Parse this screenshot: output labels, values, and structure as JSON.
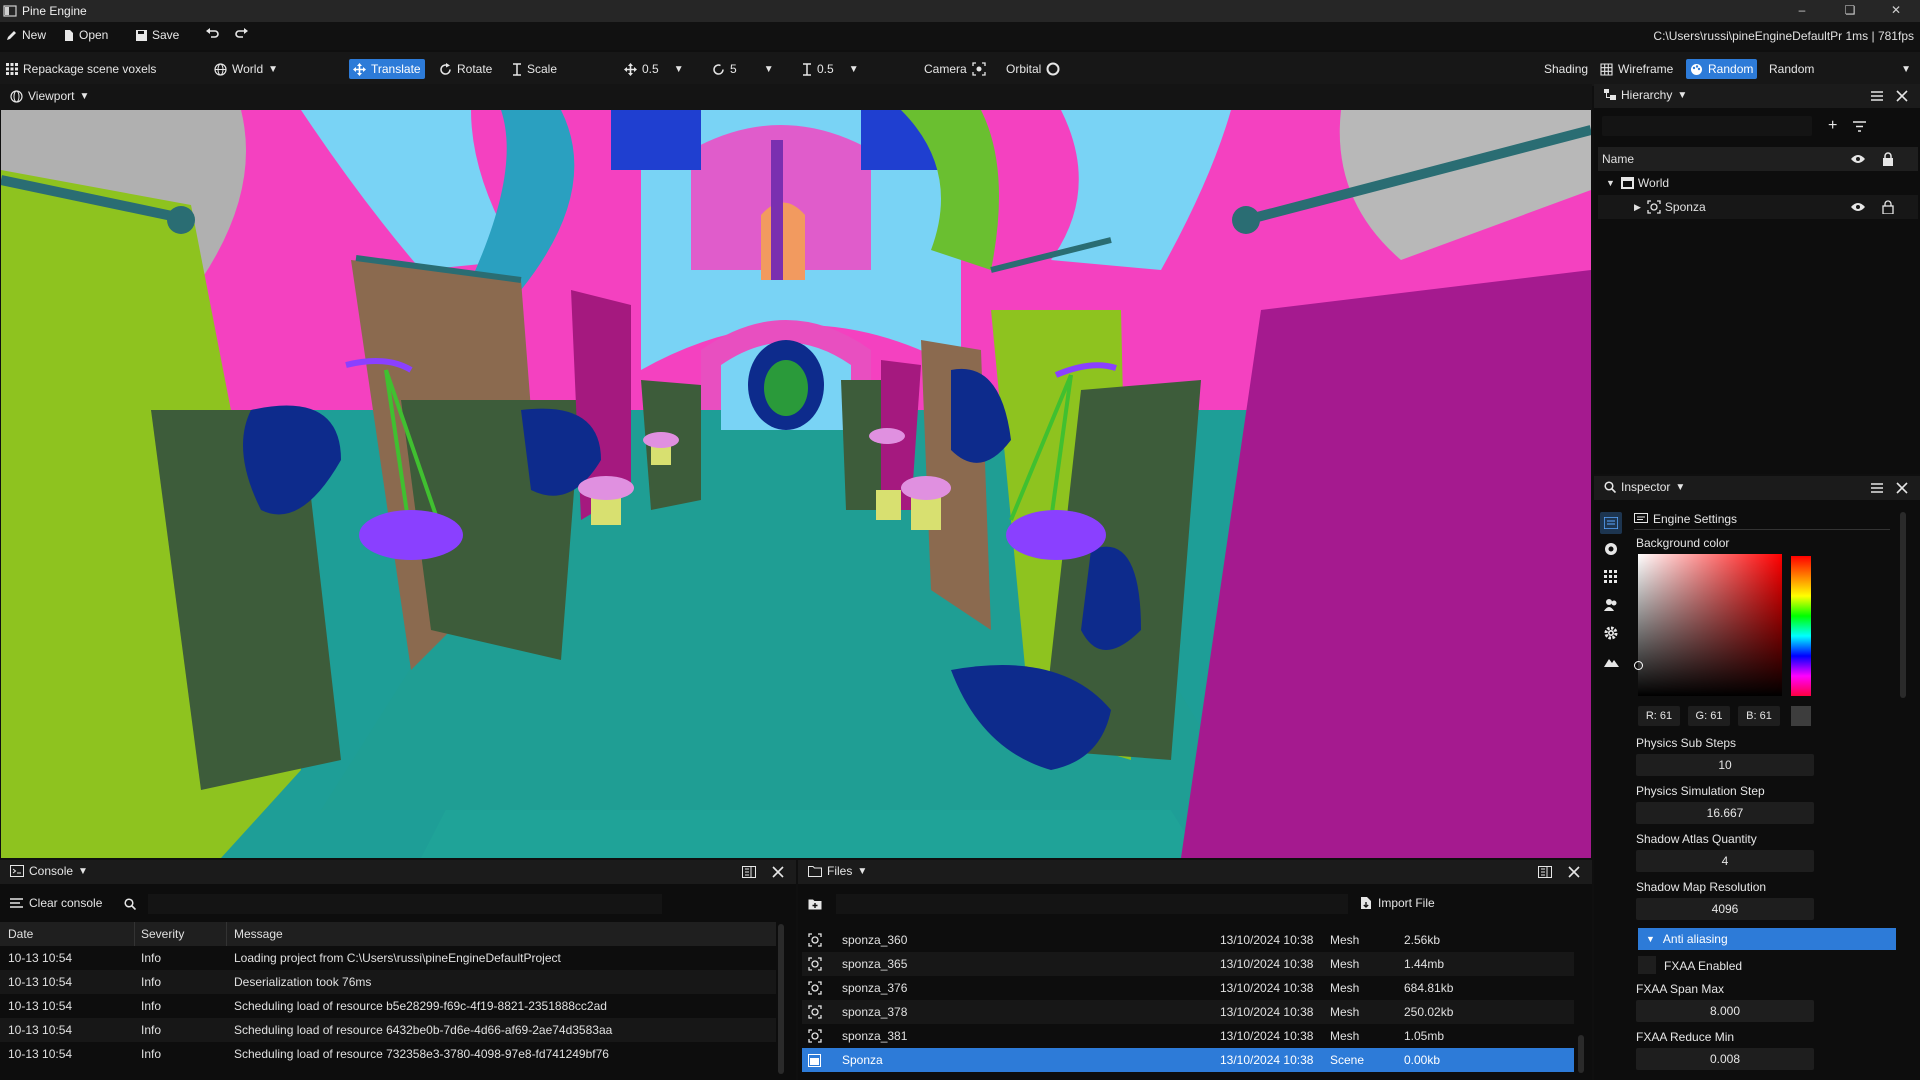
{
  "window": {
    "title": "Pine Engine"
  },
  "menu": {
    "new_label": "New",
    "open_label": "Open",
    "save_label": "Save",
    "path_status": "C:\\Users\\russi\\pineEngineDefaultPr  1ms | 781fps"
  },
  "toolbar": {
    "repackage_label": "Repackage scene voxels",
    "space_label": "World",
    "translate_label": "Translate",
    "rotate_label": "Rotate",
    "scale_label": "Scale",
    "translate_snap": "0.5",
    "rotate_snap": "5",
    "scale_snap": "0.5",
    "camera_label": "Camera",
    "orbital_label": "Orbital",
    "shading_label": "Shading",
    "wireframe_label": "Wireframe",
    "random_active_label": "Random",
    "shading_mode_value": "Random"
  },
  "viewport": {
    "label": "Viewport"
  },
  "hierarchy": {
    "label": "Hierarchy",
    "column_name": "Name",
    "items": [
      {
        "label": "World"
      },
      {
        "label": "Sponza"
      }
    ]
  },
  "inspector": {
    "label": "Inspector",
    "section_title": "Engine Settings",
    "background_color_label": "Background color",
    "rgb": {
      "r": "R: 61",
      "g": "G: 61",
      "b": "B: 61"
    },
    "fields": [
      {
        "label": "Physics Sub Steps",
        "value": "10"
      },
      {
        "label": "Physics Simulation Step",
        "value": "16.667"
      },
      {
        "label": "Shadow Atlas Quantity",
        "value": "4"
      },
      {
        "label": "Shadow Map Resolution",
        "value": "4096"
      }
    ],
    "anti_aliasing_label": "Anti aliasing",
    "fxaa_enabled_label": "FXAA Enabled",
    "fxaa_fields": [
      {
        "label": "FXAA Span Max",
        "value": "8.000"
      },
      {
        "label": "FXAA Reduce Min",
        "value": "0.008"
      }
    ]
  },
  "console": {
    "label": "Console",
    "clear_label": "Clear console",
    "columns": [
      "Date",
      "Severity",
      "Message"
    ],
    "rows": [
      {
        "date": "10-13 10:54",
        "severity": "Info",
        "message": "Loading project from C:\\Users\\russi\\pineEngineDefaultProject"
      },
      {
        "date": "10-13 10:54",
        "severity": "Info",
        "message": "Deserialization took 76ms"
      },
      {
        "date": "10-13 10:54",
        "severity": "Info",
        "message": "Scheduling load of resource b5e28299-f69c-4f19-8821-2351888cc2ad"
      },
      {
        "date": "10-13 10:54",
        "severity": "Info",
        "message": "Scheduling load of resource 6432be0b-7d6e-4d66-af69-2ae74d3583aa"
      },
      {
        "date": "10-13 10:54",
        "severity": "Info",
        "message": "Scheduling load of resource 732358e3-3780-4098-97e8-fd741249bf76"
      }
    ]
  },
  "files": {
    "label": "Files",
    "import_label": "Import File",
    "rows": [
      {
        "name": "sponza_360",
        "date": "13/10/2024 10:38",
        "type": "Mesh",
        "size": "2.56kb"
      },
      {
        "name": "sponza_365",
        "date": "13/10/2024 10:38",
        "type": "Mesh",
        "size": "1.44mb"
      },
      {
        "name": "sponza_376",
        "date": "13/10/2024 10:38",
        "type": "Mesh",
        "size": "684.81kb"
      },
      {
        "name": "sponza_378",
        "date": "13/10/2024 10:38",
        "type": "Mesh",
        "size": "250.02kb"
      },
      {
        "name": "sponza_381",
        "date": "13/10/2024 10:38",
        "type": "Mesh",
        "size": "1.05mb"
      },
      {
        "name": "Sponza",
        "date": "13/10/2024 10:38",
        "type": "Scene",
        "size": "0.00kb"
      }
    ]
  },
  "colors": {
    "accent": "#2d7bd8",
    "panel_bg": "#0d0d0d",
    "header_bg": "#1b1b1b"
  }
}
